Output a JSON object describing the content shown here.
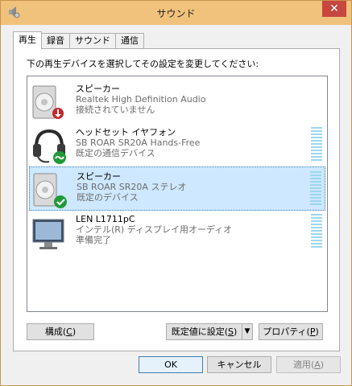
{
  "window": {
    "title": "サウンド",
    "close_label": "✕"
  },
  "tabs": [
    {
      "label": "再生",
      "active": true
    },
    {
      "label": "録音",
      "active": false
    },
    {
      "label": "サウンド",
      "active": false
    },
    {
      "label": "通信",
      "active": false
    }
  ],
  "panel": {
    "instruction": "下の再生デバイスを選択してその設定を変更してください:"
  },
  "devices": [
    {
      "name": "スピーカー",
      "description": "Realtek High Definition Audio",
      "status": "接続されていません",
      "icon": "speaker-icon",
      "badge": "disconnected-badge",
      "selected": false
    },
    {
      "name": "ヘッドセット イヤフォン",
      "description": "SB ROAR SR20A Hands-Free",
      "status": "既定の通信デバイス",
      "icon": "headset-icon",
      "badge": "default-communication-badge",
      "selected": false
    },
    {
      "name": "スピーカー",
      "description": "SB ROAR SR20A ステレオ",
      "status": "既定のデバイス",
      "icon": "speaker-icon",
      "badge": "default-device-badge",
      "selected": true
    },
    {
      "name": "LEN L1711pC",
      "description": "インテル(R) ディスプレイ用オーディオ",
      "status": "準備完了",
      "icon": "monitor-icon",
      "badge": "",
      "selected": false
    }
  ],
  "buttons": {
    "configure": {
      "label": "構成",
      "accel": "C"
    },
    "set_default": {
      "label": "既定値に設定",
      "accel": "S"
    },
    "set_default_arrow": "▼",
    "properties": {
      "label": "プロパティ",
      "accel": "P"
    },
    "ok": "OK",
    "cancel": "キャンセル",
    "apply": {
      "label": "適用",
      "accel": "A"
    }
  },
  "colors": {
    "titlebar": "#f1c27c",
    "close_button": "#c7463f",
    "selection": "#cde8ff",
    "meter": "#9dd7ee",
    "check_badge": "#1f9a38",
    "disconnected_badge": "#c3262a"
  }
}
